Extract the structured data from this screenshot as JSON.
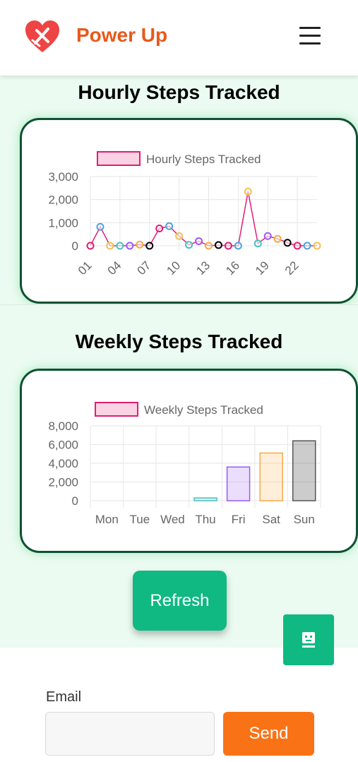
{
  "header": {
    "brand": "Power Up",
    "logo_icon": "heart-logo-icon",
    "menu_icon": "hamburger-menu-icon",
    "brand_color": "#e8591a"
  },
  "hourly": {
    "title": "Hourly Steps Tracked",
    "chart_data": {
      "type": "line",
      "legend": "Hourly Steps Tracked",
      "x": [
        "01",
        "02",
        "03",
        "04",
        "05",
        "06",
        "07",
        "08",
        "09",
        "10",
        "11",
        "12",
        "13",
        "14",
        "15",
        "16",
        "17",
        "18",
        "19",
        "20",
        "21",
        "22",
        "23",
        "24"
      ],
      "x_tick_labels": [
        "01",
        "04",
        "07",
        "10",
        "13",
        "16",
        "19",
        "22"
      ],
      "values": [
        0,
        820,
        0,
        0,
        0,
        50,
        0,
        750,
        850,
        420,
        40,
        200,
        0,
        30,
        0,
        0,
        2350,
        100,
        420,
        300,
        130,
        0,
        0,
        0
      ],
      "y_ticks": [
        "3,000",
        "2,000",
        "1,000",
        "0"
      ],
      "ylim": [
        0,
        3000
      ],
      "line_color": "#e11d74",
      "point_colors": [
        "#e11d74",
        "#4aa3df",
        "#f4c050",
        "#4bc0c0",
        "#9b59f6",
        "#f9a847",
        "#000000"
      ],
      "legend_placement": "top",
      "grid": true
    }
  },
  "weekly": {
    "title": "Weekly Steps Tracked",
    "chart_data": {
      "type": "bar",
      "legend": "Weekly Steps Tracked",
      "categories": [
        "Mon",
        "Tue",
        "Wed",
        "Thu",
        "Fri",
        "Sat",
        "Sun"
      ],
      "values": [
        0,
        0,
        0,
        300,
        3600,
        5100,
        6400
      ],
      "y_ticks": [
        "8,000",
        "6,000",
        "4,000",
        "2,000",
        "0"
      ],
      "ylim": [
        0,
        8000
      ],
      "bar_colors": [
        "#e11d74",
        "#4aa3df",
        "#f4c050",
        "#4bc0c0",
        "#9b59f6",
        "#f9a847",
        "#555555"
      ],
      "bar_fills": [
        "rgba(225,29,116,0.2)",
        "rgba(74,163,223,0.2)",
        "rgba(244,192,80,0.2)",
        "rgba(75,192,192,0.2)",
        "rgba(155,89,246,0.2)",
        "rgba(249,168,71,0.2)",
        "rgba(0,0,0,0.2)"
      ],
      "legend_placement": "top",
      "grid": true
    }
  },
  "refresh_label": "Refresh",
  "bot_icon": "robot-chat-icon",
  "footer": {
    "email_label": "Email",
    "email_placeholder": "",
    "email_value": "",
    "send_label": "Send"
  },
  "colors": {
    "accent_green": "#10b981",
    "orange": "#f97316",
    "card_border": "#0f5132",
    "section_bg": "#ebfbf1"
  }
}
